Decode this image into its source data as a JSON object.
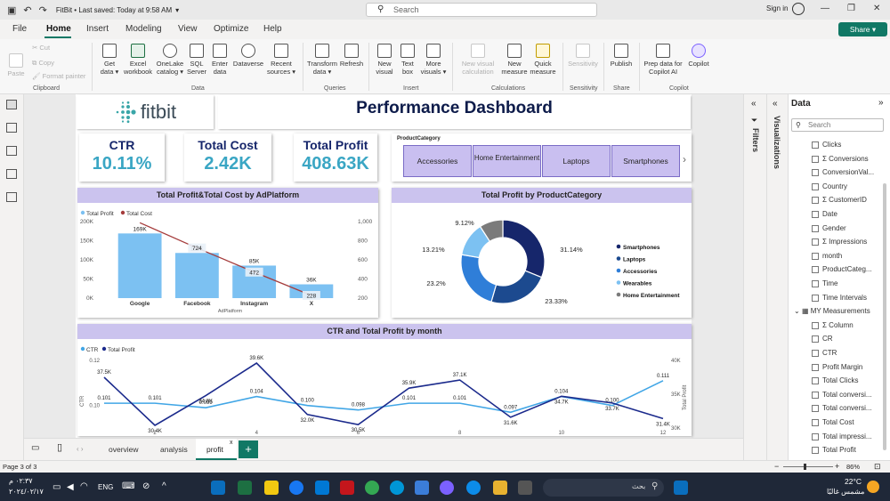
{
  "titlebar": {
    "title": "FitBit • Last saved: Today at 9:58 AM",
    "search_placeholder": "Search",
    "signin": "Sign in"
  },
  "menu": {
    "file": "File",
    "home": "Home",
    "insert": "Insert",
    "modeling": "Modeling",
    "view": "View",
    "optimize": "Optimize",
    "help": "Help",
    "share": "Share"
  },
  "ribbon": {
    "paste": "Paste",
    "cut": "Cut",
    "copy": "Copy",
    "format_painter": "Format painter",
    "clipboard": "Clipboard",
    "get_data": "Get data",
    "excel": "Excel workbook",
    "onelake": "OneLake catalog",
    "sql": "SQL Server",
    "enter": "Enter data",
    "dataverse": "Dataverse",
    "recent": "Recent sources",
    "data": "Data",
    "transform": "Transform data",
    "refresh": "Refresh",
    "queries": "Queries",
    "new_visual": "New visual",
    "text_box": "Text box",
    "more_visuals": "More visuals",
    "insert": "Insert",
    "new_visual_calc": "New visual calculation",
    "new_measure": "New measure",
    "quick_measure": "Quick measure",
    "calculations": "Calculations",
    "sensitivity": "Sensitivity",
    "sensitivity_grp": "Sensitivity",
    "publish": "Publish",
    "share_grp": "Share",
    "copilot_prep": "Prep data for Copilot AI",
    "copilot_btn": "Copilot",
    "copilot_grp": "Copilot"
  },
  "report": {
    "logo": "fitbit",
    "title": "Performance Dashboard",
    "kpis": [
      {
        "label": "CTR",
        "value": "10.11%"
      },
      {
        "label": "Total Cost",
        "value": "2.42K"
      },
      {
        "label": "Total Profit",
        "value": "408.63K"
      }
    ],
    "slicer": {
      "title": "ProductCategory",
      "items": [
        "Accessories",
        "Home Entertainment",
        "Laptops",
        "Smartphones"
      ],
      "more": "›"
    }
  },
  "chart_data": [
    {
      "type": "bar",
      "title": "Total Profit&Total Cost by AdPlatform",
      "xlabel": "AdPlatform",
      "categories": [
        "Google",
        "Facebook",
        "Instagram",
        "X"
      ],
      "series": [
        {
          "name": "Total Profit",
          "values": [
            169,
            118,
            85,
            36
          ],
          "labels": [
            "169K",
            "118K",
            "85K",
            "36K"
          ],
          "color": "#7cc1f2"
        },
        {
          "name": "Total Cost",
          "values": [
            988,
            724,
            472,
            228
          ],
          "labels": [
            "",
            "724",
            "472",
            "228"
          ],
          "color": "#a53c3c",
          "kind": "line"
        }
      ],
      "yticks_left": [
        "200K",
        "150K",
        "100K",
        "50K",
        "0K"
      ],
      "yticks_right": [
        "1,000",
        "800",
        "600",
        "400",
        "200"
      ],
      "ylim_left": [
        0,
        200
      ],
      "ylim_right": [
        200,
        1000
      ]
    },
    {
      "type": "pie",
      "title": "Total Profit by ProductCategory",
      "slices": [
        {
          "label": "Smartphones",
          "value": 31.14,
          "text": "31.14%",
          "color": "#16266b"
        },
        {
          "label": "Laptops",
          "value": 23.33,
          "text": "23.33%",
          "color": "#1c4a8f"
        },
        {
          "label": "Accessories",
          "value": 23.2,
          "text": "23.2%",
          "color": "#2f7ed8"
        },
        {
          "label": "Wearables",
          "value": 13.21,
          "text": "13.21%",
          "color": "#7cc1f2"
        },
        {
          "label": "Home Entertainment",
          "value": 9.12,
          "text": "9.12%",
          "color": "#7b7b7b"
        }
      ]
    },
    {
      "type": "line",
      "title": "CTR and Total Profit by month",
      "xlabel": "month",
      "x": [
        1,
        2,
        3,
        4,
        5,
        6,
        7,
        8,
        9,
        10,
        11,
        12
      ],
      "xticks": [
        "2",
        "4",
        "6",
        "8",
        "10",
        "12"
      ],
      "series": [
        {
          "name": "CTR",
          "values": [
            0.101,
            0.101,
            0.099,
            0.104,
            0.1,
            0.098,
            0.101,
            0.101,
            0.097,
            0.104,
            0.1,
            0.111
          ],
          "labels": [
            "0.101",
            "0.101",
            "0.099",
            "0.104",
            "0.100",
            "0.098",
            "0.101",
            "0.101",
            "0.097",
            "0.104",
            "0.100",
            "0.111"
          ],
          "color": "#41a6e6"
        },
        {
          "name": "Total Profit",
          "values": [
            37.5,
            30.4,
            34.8,
            39.6,
            32.0,
            30.5,
            35.9,
            37.1,
            31.6,
            34.7,
            33.7,
            31.4
          ],
          "labels": [
            "37.5K",
            "30.4K",
            "34.8K",
            "39.6K",
            "32.0K",
            "30.5K",
            "35.9K",
            "37.1K",
            "31.6K",
            "34.7K",
            "33.7K",
            "31.4K"
          ],
          "color": "#1b2a8c"
        }
      ],
      "yticks_left": [
        "0.12",
        "0.10"
      ],
      "yticks_right": [
        "40K",
        "35K",
        "30K"
      ],
      "ylabel_left": "CTR",
      "ylabel_right": "Total Profit",
      "ylim_left": [
        0.09,
        0.12
      ],
      "ylim_right": [
        30,
        40
      ]
    }
  ],
  "panes": {
    "filters": "Filters",
    "visualizations": "Visualizations",
    "data": "Data",
    "search": "Search"
  },
  "fields": [
    "Clicks",
    "Conversions",
    "ConversionVal...",
    "Country",
    "CustomerID",
    "Date",
    "Gender",
    "Impressions",
    "month",
    "ProductCateg...",
    "Time",
    "Time Intervals",
    "MY Measurements",
    "Column",
    "CR",
    "CTR",
    "Profit Margin",
    "Total Clicks",
    "Total conversi...",
    "Total conversi...",
    "Total Cost",
    "Total impressi...",
    "Total Profit"
  ],
  "pages": {
    "overview": "overview",
    "analysis": "analysis",
    "profit": "profit",
    "add": "+"
  },
  "status": {
    "page": "Page 3 of 3",
    "zoom": "86%"
  },
  "taskbar": {
    "time": "٠٢:٣٧ م",
    "date": "٢٠٢٤/٠٢/١٧",
    "lang": "ENG",
    "search": "بحث",
    "weather": "22°C",
    "weather_desc": "مشمس غالبًا"
  }
}
